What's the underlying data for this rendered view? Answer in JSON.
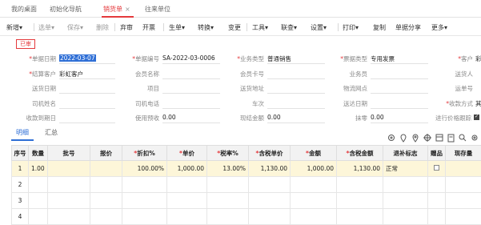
{
  "tabs": [
    {
      "label": "我的桌面"
    },
    {
      "label": "初始化导航"
    },
    {
      "label": "销货单",
      "close": "×"
    },
    {
      "label": "往来单位"
    }
  ],
  "toolbar": {
    "new": "新增",
    "select": "选单",
    "save": "保存",
    "delete": "删除",
    "audit": "弃审",
    "invoice": "开票",
    "generate": "生单",
    "convert": "转换",
    "change": "变更",
    "tools": "工具",
    "linkquery": "联查",
    "settings": "设置",
    "print": "打印",
    "copy": "复制",
    "share": "单据分享",
    "more": "更多",
    "caret": "▾"
  },
  "stamp": "已审",
  "form": {
    "doc_date": {
      "label": "单据日期",
      "value": "2022-03-07"
    },
    "doc_no": {
      "label": "单据编号",
      "value": "SA-2022-03-0006"
    },
    "biz_type": {
      "label": "业务类型",
      "value": "普通销售"
    },
    "invoice_type": {
      "label": "票据类型",
      "value": "专用发票"
    },
    "customer": {
      "label": "客户",
      "value": "彩"
    },
    "settle_customer": {
      "label": "结算客户",
      "value": "彩虹客户"
    },
    "member_name": {
      "label": "会员名称"
    },
    "member_card": {
      "label": "会员卡号"
    },
    "salesperson": {
      "label": "业务员"
    },
    "sender": {
      "label": "送货人"
    },
    "ship_date": {
      "label": "送货日期"
    },
    "project": {
      "label": "项目"
    },
    "ship_address": {
      "label": "送货地址"
    },
    "logistics": {
      "label": "物流网点"
    },
    "ship_no": {
      "label": "运单号"
    },
    "driver": {
      "label": "司机姓名"
    },
    "driver_phone": {
      "label": "司机电话"
    },
    "vehicle": {
      "label": "车次"
    },
    "arrive_date": {
      "label": "送达日期"
    },
    "pay_method": {
      "label": "收款方式",
      "value": "其"
    },
    "due_date": {
      "label": "收款到期日"
    },
    "prepaid": {
      "label": "使用预收",
      "value": "0.00"
    },
    "cash": {
      "label": "现结金额",
      "value": "0.00"
    },
    "discount": {
      "label": "抹零",
      "value": "0.00"
    },
    "price_track": {
      "label": "进行价格跟踪"
    }
  },
  "subtabs": {
    "detail": "明细",
    "summary": "汇总"
  },
  "grid": {
    "headers": {
      "seq": "序号",
      "qty": "数量",
      "batch": "批号",
      "quote": "报价",
      "discount_pct": "折扣%",
      "price": "单价",
      "tax_rate": "税率%",
      "tax_price": "含税单价",
      "amount": "金额",
      "tax_amount": "含税金额",
      "return_flag": "退补标志",
      "gift": "赠品",
      "stock": "现存量"
    },
    "rows": [
      {
        "seq": "1",
        "qty": "1.00",
        "batch": "",
        "quote": "",
        "discount_pct": "100.00%",
        "price": "1,000.00",
        "tax_rate": "13.00%",
        "tax_price": "1,130.00",
        "amount": "1,000.00",
        "tax_amount": "1,130.00",
        "return_flag": "正常",
        "stock": ""
      },
      {
        "seq": "2"
      },
      {
        "seq": "3"
      },
      {
        "seq": "4"
      }
    ]
  }
}
